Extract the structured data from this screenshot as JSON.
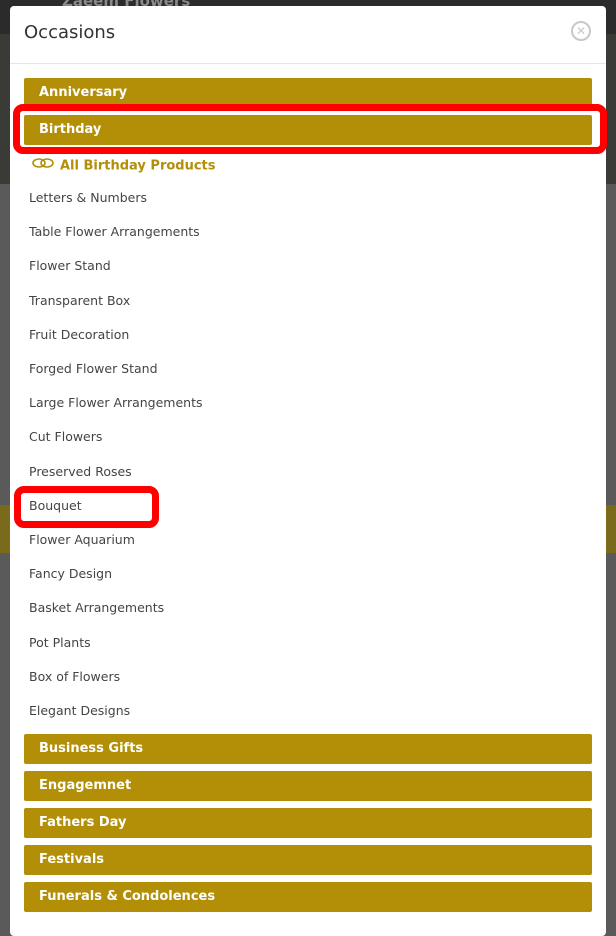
{
  "background": {
    "header_text": "Zaeem Flowers"
  },
  "modal": {
    "title": "Occasions",
    "close_icon": "close-circle-icon"
  },
  "categories_top": [
    {
      "label": "Anniversary"
    },
    {
      "label": "Birthday"
    }
  ],
  "birthday": {
    "all_label": "All Birthday Products",
    "all_icon": "link-icon",
    "items": [
      "Letters & Numbers",
      "Table Flower Arrangements",
      "Flower Stand",
      "Transparent Box",
      "Fruit Decoration",
      "Forged Flower Stand",
      "Large Flower Arrangements",
      "Cut Flowers",
      "Preserved Roses",
      "Bouquet",
      "Flower Aquarium",
      "Fancy Design",
      "Basket Arrangements",
      "Pot Plants",
      "Box of Flowers",
      "Elegant Designs"
    ]
  },
  "categories_bottom": [
    {
      "label": "Business Gifts"
    },
    {
      "label": "Engagemnet"
    },
    {
      "label": "Fathers Day"
    },
    {
      "label": "Festivals"
    },
    {
      "label": "Funerals & Condolences"
    }
  ],
  "colors": {
    "accent": "#b28f07",
    "highlight": "#ff0000"
  }
}
